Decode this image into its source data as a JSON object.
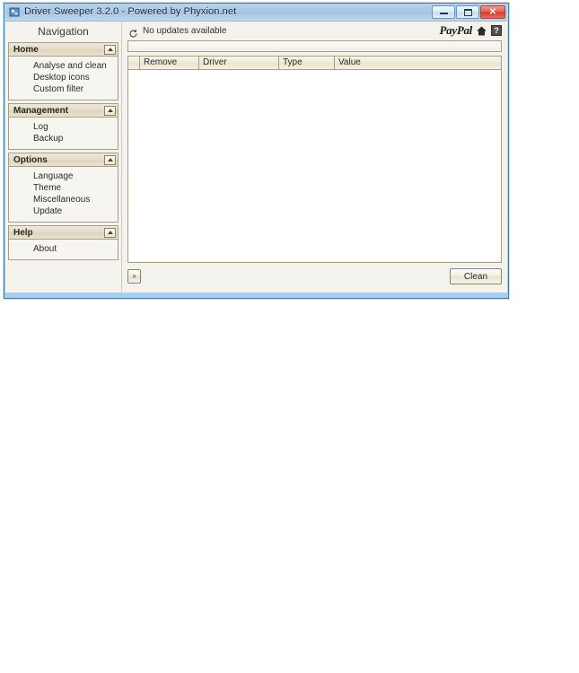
{
  "window": {
    "title": "Driver Sweeper 3.2.0 - Powered by Phyxion.net",
    "icon": "app-icon",
    "controls": {
      "minimize_label": "Minimize",
      "maximize_label": "Maximize",
      "close_label": "Close",
      "close_glyph": "✕"
    },
    "colors": {
      "titlebar_top": "#b9d2ea",
      "titlebar_bottom": "#bcd9ef",
      "border": "#3f7fa5",
      "close_button": "#cf3a26",
      "client_bg": "#f4f2ec",
      "panel_bg": "#f7f5ef",
      "group_header": "#e4dcc6",
      "group_border": "#a89d85"
    }
  },
  "sidebar": {
    "title": "Navigation",
    "groups": [
      {
        "label": "Home",
        "collapse_icon": "chevron-up-icon",
        "items": [
          {
            "label": "Analyse and clean"
          },
          {
            "label": "Desktop icons"
          },
          {
            "label": "Custom filter"
          }
        ]
      },
      {
        "label": "Management",
        "collapse_icon": "chevron-up-icon",
        "items": [
          {
            "label": "Log"
          },
          {
            "label": "Backup"
          }
        ]
      },
      {
        "label": "Options",
        "collapse_icon": "chevron-up-icon",
        "items": [
          {
            "label": "Language"
          },
          {
            "label": "Theme"
          },
          {
            "label": "Miscellaneous"
          },
          {
            "label": "Update"
          }
        ]
      },
      {
        "label": "Help",
        "collapse_icon": "chevron-up-icon",
        "items": [
          {
            "label": "About"
          }
        ]
      }
    ]
  },
  "main": {
    "status": {
      "icon": "refresh-icon",
      "text": "No updates available"
    },
    "brand": {
      "paypal_label": "PayPal",
      "home_icon": "home-icon",
      "help_icon": "help-icon",
      "help_glyph": "?"
    },
    "progress": {
      "value": 0
    },
    "table": {
      "columns": [
        {
          "label": ""
        },
        {
          "label": "Remove"
        },
        {
          "label": "Driver"
        },
        {
          "label": "Type"
        },
        {
          "label": "Value"
        }
      ],
      "rows": []
    },
    "footer": {
      "expand_label": "»",
      "clean_label": "Clean"
    }
  }
}
